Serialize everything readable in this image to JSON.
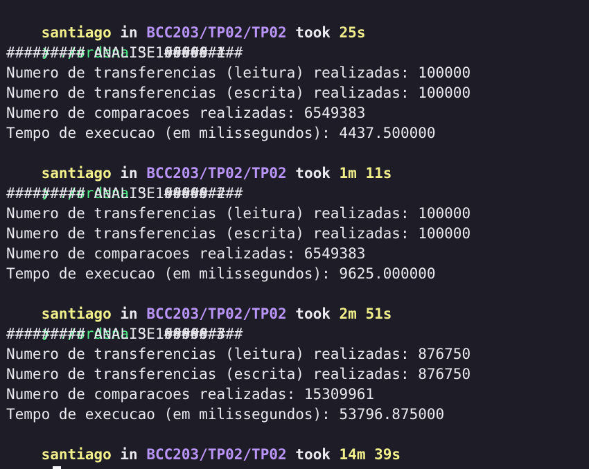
{
  "terminal": {
    "prompt_symbol": "❯",
    "and_word": "in",
    "took_word": "took",
    "user": "santiago",
    "path": "BCC203/TP02/TP02",
    "blocks": [
      {
        "took": "25s",
        "command": "./ordena",
        "args": "3 100000 1",
        "output": [
          "######### ANALISE #########",
          "Numero de transferencias (leitura) realizadas: 100000",
          "Numero de transferencias (escrita) realizadas: 100000",
          "Numero de comparacoes realizadas: 6549383",
          "Tempo de execucao (em milissegundos): 4437.500000"
        ]
      },
      {
        "took": "1m 11s",
        "command": "./ordena",
        "args": "3 100000 2",
        "output": [
          "######### ANALISE #########",
          "Numero de transferencias (leitura) realizadas: 100000",
          "Numero de transferencias (escrita) realizadas: 100000",
          "Numero de comparacoes realizadas: 6549383",
          "Tempo de execucao (em milissegundos): 9625.000000"
        ]
      },
      {
        "took": "2m 51s",
        "command": "./ordena",
        "args": "3 100000 3",
        "output": [
          "######### ANALISE #########",
          "Numero de transferencias (leitura) realizadas: 876750",
          "Numero de transferencias (escrita) realizadas: 876750",
          "Numero de comparacoes realizadas: 15309961",
          "Tempo de execucao (em milissegundos): 53796.875000"
        ]
      }
    ],
    "final_took": "14m 39s"
  }
}
